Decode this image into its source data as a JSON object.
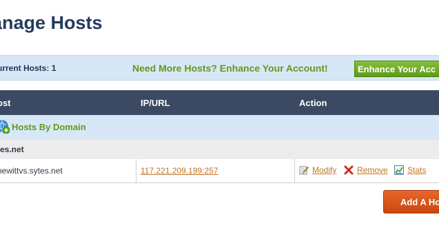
{
  "page": {
    "title": "anage Hosts"
  },
  "info_bar": {
    "current_hosts_label": "urrent Hosts:",
    "current_hosts_count": "1",
    "promo_text": "Need More Hosts? Enhance Your Account!",
    "enhance_button": "Enhance Your Acc"
  },
  "table": {
    "headers": {
      "host": "ost",
      "ip_url": "IP/URL",
      "action": "Action"
    },
    "group_label": "Hosts By Domain",
    "domain": "tes.net",
    "rows": [
      {
        "host": "newittvs.sytes.net",
        "ip": "117.221.209.199:257",
        "actions": {
          "modify": "Modify",
          "remove": "Remove",
          "stats": "Stats"
        }
      }
    ]
  },
  "add_button": "Add A Ho",
  "colors": {
    "accent_green": "#5f9a1a",
    "header_bg": "#3b4a62",
    "link_orange": "#c07524",
    "add_button": "#d9561b"
  },
  "icons": {
    "group": "globe-add-icon",
    "modify": "edit-icon",
    "remove": "remove-x-icon",
    "stats": "chart-icon"
  }
}
